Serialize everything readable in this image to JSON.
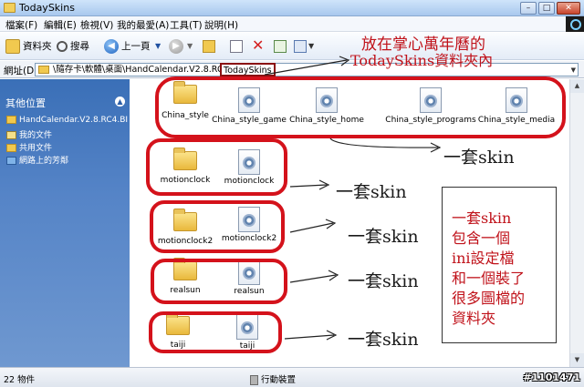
{
  "window": {
    "title": "TodaySkins"
  },
  "menu": [
    "檔案(F)",
    "編輯(E)",
    "檢視(V)",
    "我的最愛(A)",
    "工具(T)",
    "說明(H)"
  ],
  "toolbar": {
    "folders": "資料夾",
    "search": "搜尋",
    "back": "上一頁"
  },
  "address": {
    "label": "網址(D)",
    "path": "\\隨存卡\\軟體\\桌面\\HandCalendar.V2.8.RC4.BIG5\\",
    "current": "TodaySkins"
  },
  "sidebar": {
    "title": "其他位置",
    "items": [
      "HandCalendar.V2.8.RC4.BI(",
      "我的文件",
      "共用文件",
      "網路上的芳鄰"
    ]
  },
  "files": [
    "China_style",
    "China_style_game",
    "China_style_home",
    "China_style_programs",
    "China_style_media",
    "motionclock",
    "motionclock",
    "motionclock2",
    "motionclock2",
    "realsun",
    "realsun",
    "taiji",
    "taiji"
  ],
  "annotations": {
    "header_line1": "放在掌心萬年曆的",
    "header_line2": "TodaySkins資料夾內",
    "set_label": "一套skin",
    "note_lines": [
      "一套skin",
      "包含一個",
      "ini設定檔",
      "和一個裝了",
      "很多圖檔的",
      "資料夾"
    ]
  },
  "status": {
    "count": "22 物件",
    "location": "行動裝置",
    "watermark": "#1101471"
  },
  "colors": {
    "annotation_red": "#d4121b",
    "sidebar_blue": "#4a7bc0"
  }
}
